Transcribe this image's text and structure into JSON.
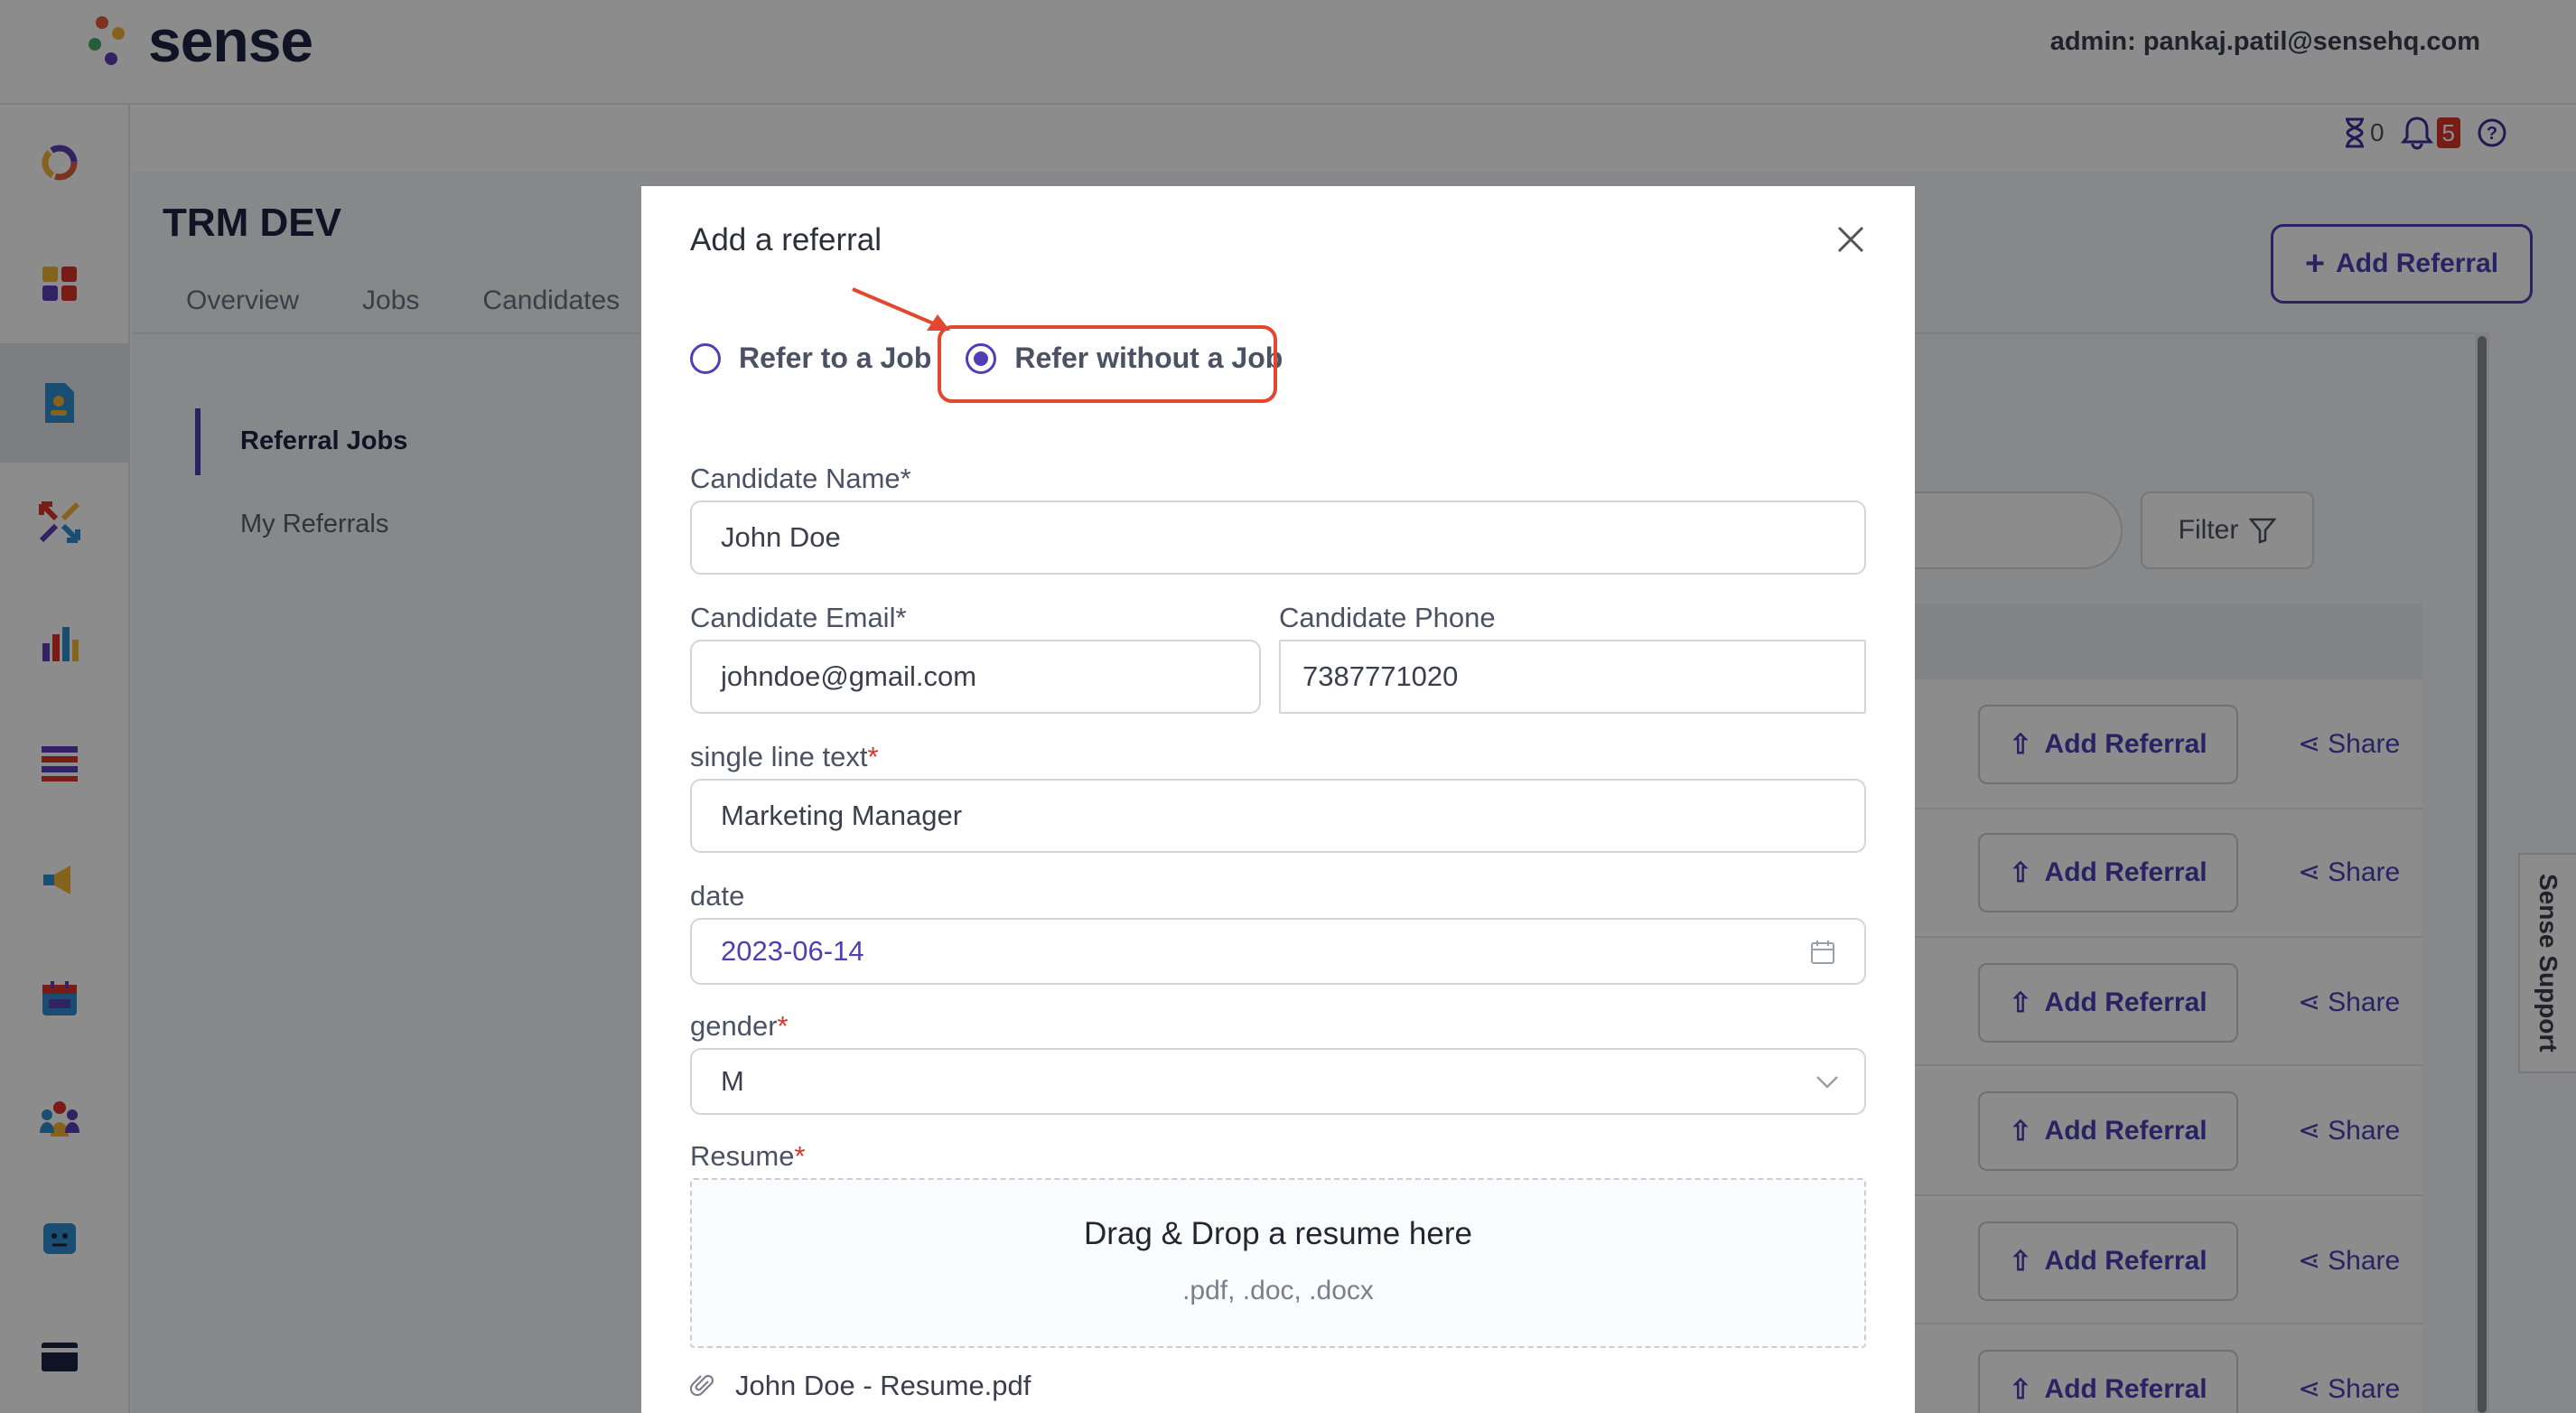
{
  "header": {
    "logo_text": "sense",
    "admin_label": "admin: pankaj.patil@sensehq.com",
    "hourglass_count": "0",
    "notification_count": "5"
  },
  "page": {
    "title": "TRM DEV",
    "tabs": [
      "Overview",
      "Jobs",
      "Candidates"
    ],
    "side_nav": [
      "Referral Jobs",
      "My Referrals"
    ],
    "add_referral_top": "Add Referral",
    "filter_label": "Filter",
    "row_add_label": "Add Referral",
    "row_share_label": "Share",
    "support_label": "Sense Support"
  },
  "modal": {
    "title": "Add a referral",
    "radio_options": [
      "Refer to a Job",
      "Refer without a Job"
    ],
    "selected_option": "Refer without a Job",
    "fields": {
      "name_label": "Candidate Name",
      "name_value": "John Doe",
      "email_label": "Candidate Email",
      "email_value": "johndoe@gmail.com",
      "phone_label": "Candidate Phone",
      "phone_value": "7387771020",
      "single_line_label": "single line text",
      "single_line_value": "Marketing Manager",
      "date_label": "date",
      "date_value": "2023-06-14",
      "gender_label": "gender",
      "gender_value": "M",
      "resume_label": "Resume"
    },
    "required_mark": "*",
    "dropzone": {
      "title": "Drag & Drop a resume here",
      "formats": ".pdf, .doc, .docx"
    },
    "attached_file": "John Doe - Resume.pdf"
  },
  "colors": {
    "accent": "#4f3fb6",
    "highlight": "#e2472f",
    "badge": "#d9342b"
  }
}
